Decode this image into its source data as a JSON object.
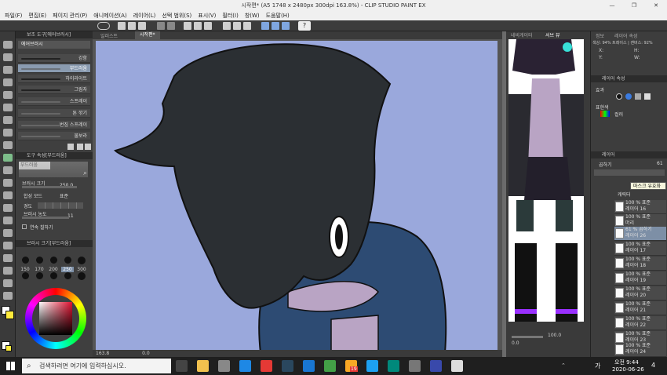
{
  "window": {
    "title": "시작편* (A5 1748 x 2480px 300dpi 163.8%) - CLIP STUDIO PAINT EX",
    "minimize": "—",
    "maximize": "❐",
    "close": "✕"
  },
  "menu": [
    "파일(F)",
    "편집(E)",
    "페이지 관리(P)",
    "애니메이션(A)",
    "레이어(L)",
    "선택 범위(S)",
    "표시(V)",
    "필터(I)",
    "창(W)",
    "도움말(H)"
  ],
  "canvas_tabs": [
    "일러스트",
    "시작편*"
  ],
  "sub_tool": {
    "header": "보조 도구[에어브러시]",
    "group": "에어브러시",
    "brushes": [
      "강함",
      "부드러움",
      "하이라이트",
      "그림자",
      "스프레이",
      "톤 깎기",
      "번짐 스프레이",
      "물보라"
    ],
    "selected": "부드러움"
  },
  "tool_property": {
    "header": "도구 속성[부드러움]",
    "preview_label": "부드러움",
    "brush_size_label": "브러시 크기",
    "brush_size": "250.0",
    "blend_mode_label": "합성 모드",
    "blend_mode": "표준",
    "hardness_label": "경도",
    "brush_density_label": "브러시 농도",
    "brush_density": "11",
    "continuous_spray": "연속 칠하기"
  },
  "brush_size_panel": {
    "header": "브러시 크기[부드러움]",
    "sizes": [
      "150",
      "170",
      "200",
      "250",
      "300"
    ]
  },
  "canvas_status": {
    "zoom": "163.8",
    "angle": "0.0"
  },
  "navigator": {
    "tabs": [
      "네비게이터",
      "서브 뷰"
    ],
    "zoom": "100.0",
    "angle": "0.0"
  },
  "info_panel": {
    "tabs": [
      "정보",
      "레이어 속성"
    ],
    "summary": "색상: 94% 트레이스 | 캔버스: 92%",
    "x": "X:",
    "y": "Y:",
    "h": "H:",
    "w": "W:"
  },
  "layer_property": {
    "header": "레이어 속성",
    "effect_label": "효과",
    "expression_label": "표현색",
    "expression": "컬러"
  },
  "layer_panel": {
    "header": "레이어",
    "blend": "곱하기",
    "opacity": "61",
    "tooltip": "마스크 유효화",
    "layers": [
      {
        "line1": "100 % 표준",
        "line2": "레이어 16"
      },
      {
        "line1": "100 % 표준",
        "line2": "레이어 14"
      },
      {
        "line1": "61 % 곱하기",
        "line2": "레이어 26",
        "selected": true
      },
      {
        "line1": "100 % 표준",
        "line2": "레이어 17"
      },
      {
        "line1": "100 % 표준",
        "line2": "레이어 18"
      },
      {
        "line1": "100 % 표준",
        "line2": "레이어 19"
      },
      {
        "line1": "100 % 표준",
        "line2": "레이어 20"
      },
      {
        "line1": "100 % 표준",
        "line2": "레이어 21"
      },
      {
        "line1": "100 % 표준",
        "line2": "레이어 22"
      },
      {
        "line1": "100 % 표준",
        "line2": "레이어 23"
      },
      {
        "line1": "100 % 표준",
        "line2": "레이어 24"
      }
    ],
    "folder1": "캐릭터",
    "folder2": "머리"
  },
  "taskbar": {
    "search_placeholder": "검색하려면 여기에 입력하십시오.",
    "time": "오전 9:44",
    "date": "2020-06-26",
    "lang": "가",
    "notif": "4",
    "badge": "19"
  },
  "colors": {
    "canvas_bg": "#9aa8dc",
    "hair": "#2b2f33",
    "hoodie": "#2d4b73",
    "collar": "#b9a4c4"
  }
}
